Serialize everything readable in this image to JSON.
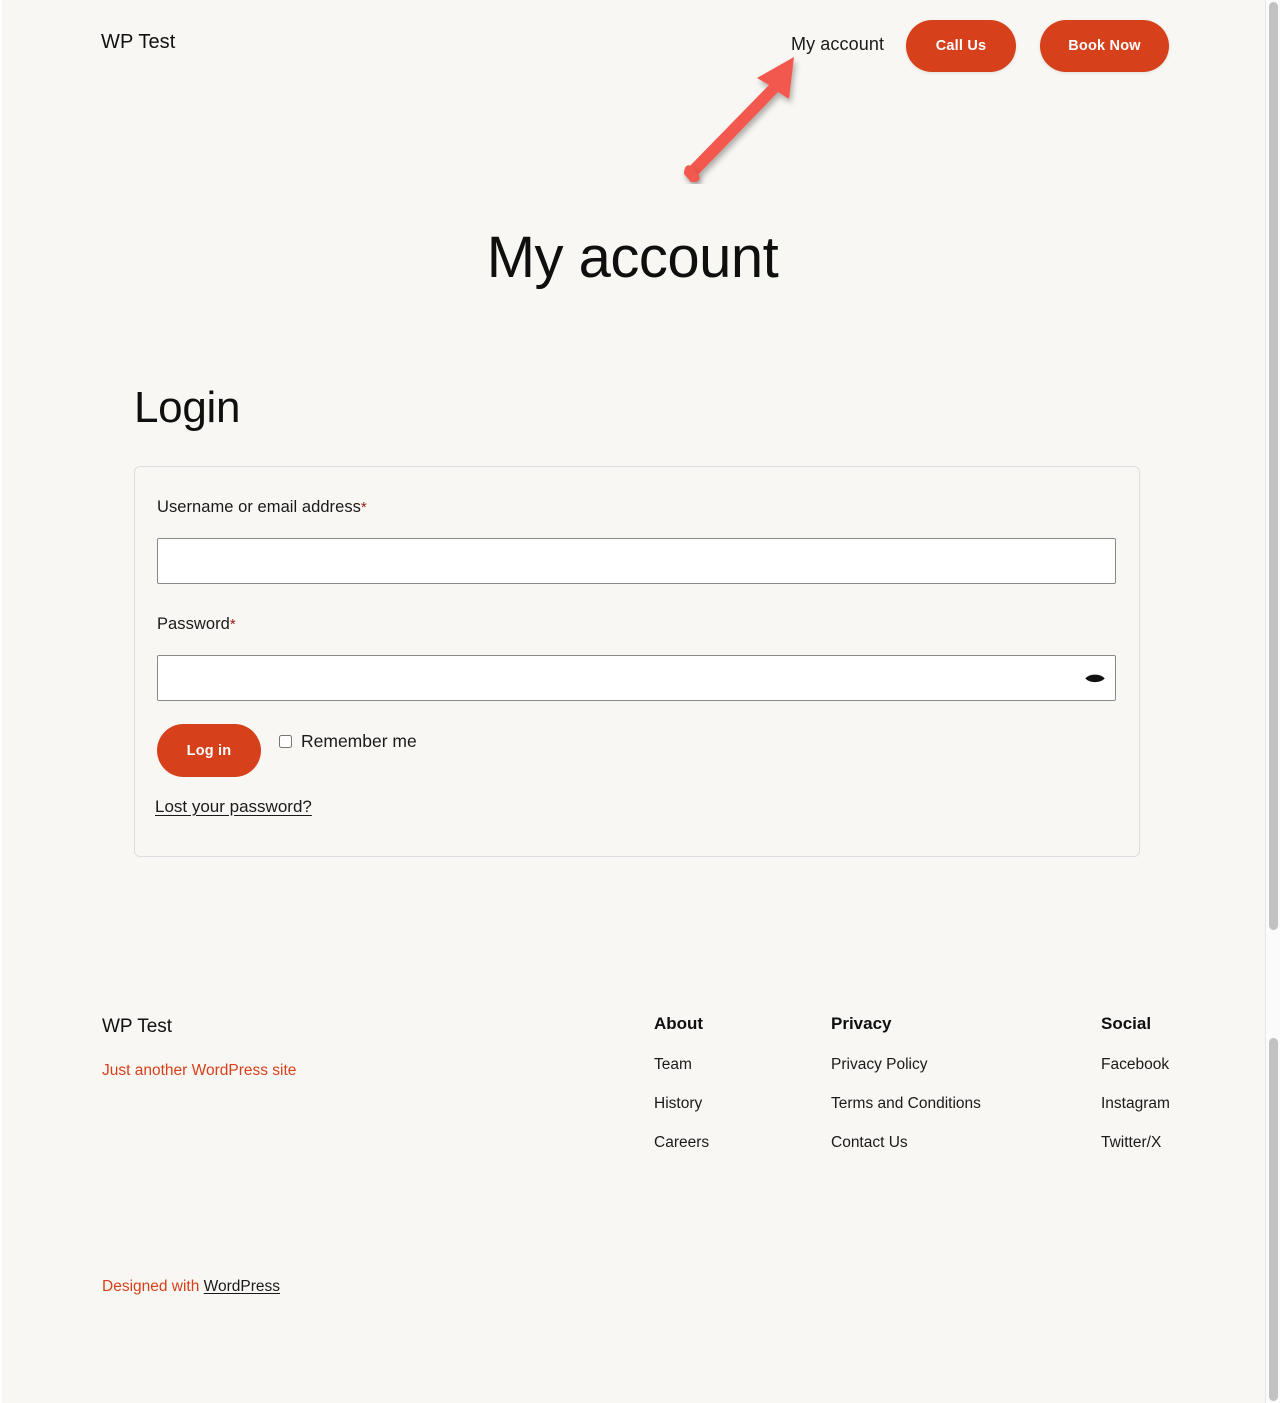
{
  "header": {
    "site_title": "WP Test",
    "nav_account_label": "My account",
    "call_us_label": "Call Us",
    "book_now_label": "Book Now",
    "accent_color": "#D6401A"
  },
  "annotation": {
    "type": "arrow",
    "color": "#F2584D",
    "points_to": "My account"
  },
  "page": {
    "title": "My account",
    "background_color": "#F8F7F3"
  },
  "login": {
    "heading": "Login",
    "username_label": "Username or email address",
    "username_required_mark": "*",
    "username_value": "",
    "username_placeholder": "",
    "password_label": "Password",
    "password_required_mark": "*",
    "password_value": "",
    "password_placeholder": "",
    "show_password_icon": "eye-icon",
    "submit_label": "Log in",
    "remember_label": "Remember me",
    "remember_checked": false,
    "lost_password_label": "Lost your password?"
  },
  "footer": {
    "brand": "WP Test",
    "tagline": "Just another WordPress site",
    "tagline_color": "#D6401A",
    "columns": [
      {
        "title": "About",
        "links": [
          "Team",
          "History",
          "Careers"
        ]
      },
      {
        "title": "Privacy",
        "links": [
          "Privacy Policy",
          "Terms and Conditions",
          "Contact Us"
        ]
      },
      {
        "title": "Social",
        "links": [
          "Facebook",
          "Instagram",
          "Twitter/X"
        ]
      }
    ],
    "colophon_prefix": "Designed with ",
    "colophon_link": "WordPress"
  }
}
